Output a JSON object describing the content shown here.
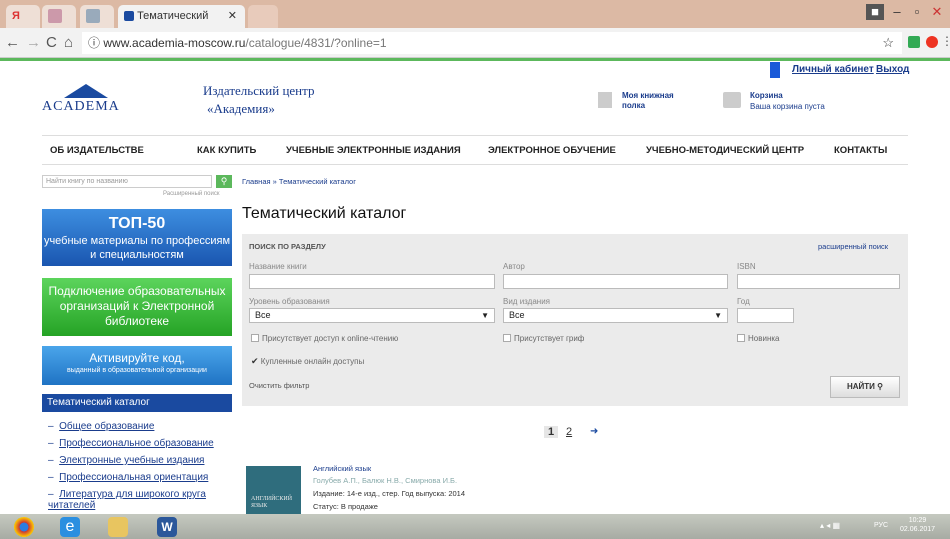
{
  "browser": {
    "tab_title": "Тематический каталог",
    "tab_close": "✕",
    "url_host": "www.academia-moscow.ru",
    "url_path": "/catalogue/4831/?online=1",
    "info_glyph": "ⓘ"
  },
  "header": {
    "logo_word": "ACADEMA",
    "logo_line1": "Издательский центр",
    "logo_line2": "«Академия»",
    "cabinet": "Личный кабинет",
    "logout": "Выход",
    "shelf": "Моя книжная полка",
    "cart": "Корзина",
    "cart_status": "Ваша корзина пуста"
  },
  "menu": [
    "ОБ ИЗДАТЕЛЬСТВЕ",
    "КАК КУПИТЬ",
    "УЧЕБНЫЕ ЭЛЕКТРОННЫЕ ИЗДАНИЯ",
    "ЭЛЕКТРОННОЕ ОБУЧЕНИЕ",
    "УЧЕБНО-МЕТОДИЧЕСКИЙ ЦЕНТР",
    "КОНТАКТЫ"
  ],
  "sidebar": {
    "search_placeholder": "Найти книгу по названию",
    "advanced_search": "Расширенный поиск",
    "banner1_title": "ТОП-50",
    "banner1_sub": "учебные материалы по профессиям и специальностям",
    "banner2": "Подключение образовательных организаций к Электронной библиотеке",
    "banner3_title": "Активируйте код,",
    "banner3_sub": "выданный в образовательной организации",
    "catalog_title": "Тематический каталог",
    "catalog_items": [
      "Общее образование",
      "Профессиональное образование",
      "Электронные учебные издания",
      "Профессиональная ориентация",
      "Литература для широкого круга читателей"
    ]
  },
  "breadcrumb": {
    "home": "Главная",
    "sep": "»",
    "current": "Тематический каталог"
  },
  "page_title": "Тематический каталог",
  "filter": {
    "heading": "ПОИСК ПО РАЗДЕЛУ",
    "advanced": "расширенный поиск",
    "book_name": "Название книги",
    "author": "Автор",
    "isbn": "ISBN",
    "level": "Уровень образования",
    "level_value": "Все",
    "edition_type": "Вид издания",
    "edition_value": "Все",
    "year": "Год",
    "online_reading": "Присутствует доступ к online-чтению",
    "stamp": "Присутствует гриф",
    "new": "Новинка",
    "purchased": "Купленные онлайн доступы",
    "clear": "Очистить фильтр",
    "find": "НАЙТИ"
  },
  "pagination": {
    "current": "1",
    "next_page": "2",
    "arrow": "➜"
  },
  "book": {
    "title": "Английский язык",
    "authors": "Голубев А.П., Балюк Н.В., Смирнова И.Б.",
    "edition": "Издание: 14-е изд., стер. Год выпуска: 2014",
    "status": "Статус: В продаже",
    "cover_text": "АНГЛИЙСКИЙ ЯЗЫК"
  },
  "taskbar": {
    "lang": "РУС",
    "time": "10:29",
    "date": "02.06.2017"
  },
  "colors": {
    "accent_blue": "#1a4aa0",
    "accent_green": "#5cb85c"
  }
}
